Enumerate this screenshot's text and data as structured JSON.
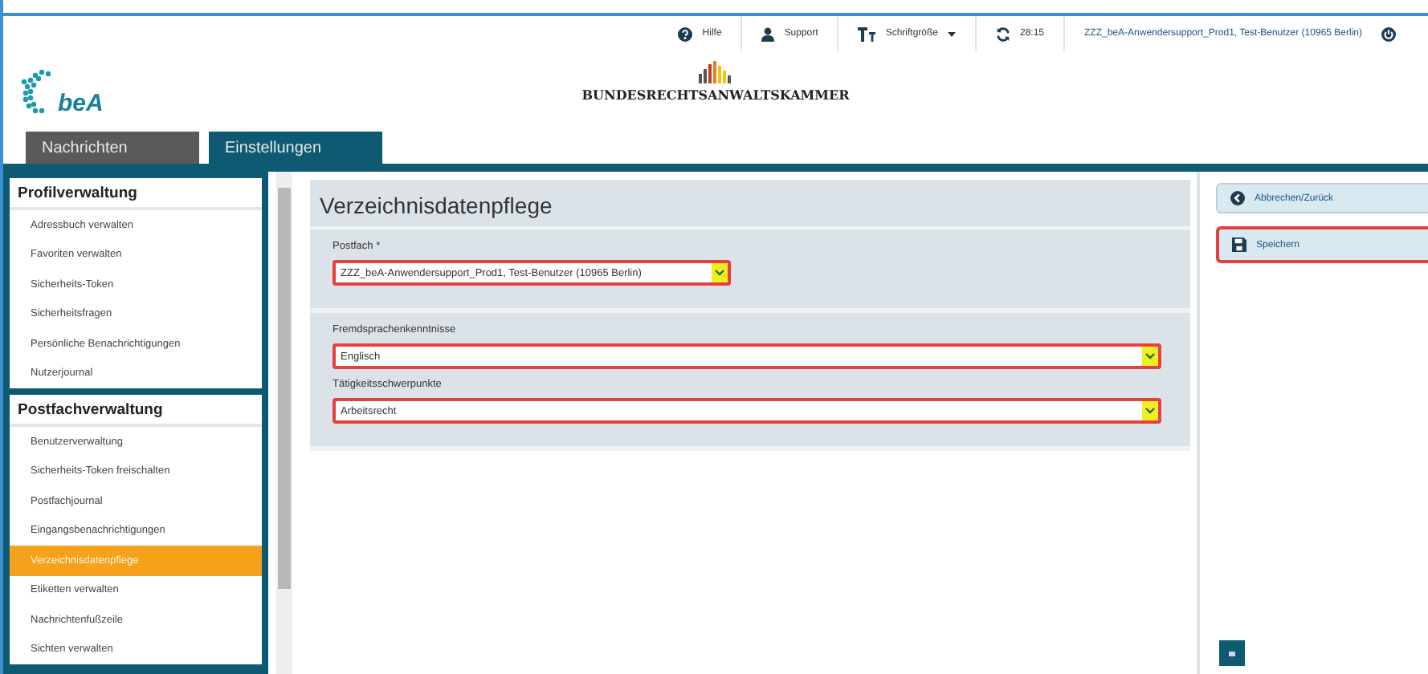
{
  "top_bar": {
    "items": [
      {
        "kind": "help",
        "label": "Hilfe"
      },
      {
        "kind": "user",
        "label": "Support"
      },
      {
        "kind": "font",
        "label": "Schriftgröße"
      },
      {
        "kind": "refresh",
        "label": "28:15"
      },
      {
        "kind": "account",
        "label": "ZZZ_beA-Anwendersupport_Prod1, Test-Benutzer (10965 Berlin)"
      }
    ]
  },
  "header": {
    "logo_text": "beA",
    "organization": "BUNDESRECHTSANWALTSKAMMER"
  },
  "tabs": [
    {
      "label": "Nachrichten",
      "selected": false
    },
    {
      "label": "Einstellungen",
      "selected": true
    }
  ],
  "sidebar": {
    "sections": [
      {
        "title": "Profilverwaltung",
        "items": [
          {
            "label": "Adressbuch verwalten",
            "selected": false
          },
          {
            "label": "Favoriten verwalten",
            "selected": false
          },
          {
            "label": "Sicherheits-Token",
            "selected": false
          },
          {
            "label": "Sicherheitsfragen",
            "selected": false
          },
          {
            "label": "Persönliche Benachrichtigungen",
            "selected": false
          },
          {
            "label": "Nutzerjournal",
            "selected": false
          }
        ]
      },
      {
        "title": "Postfachverwaltung",
        "items": [
          {
            "label": "Benutzerverwaltung",
            "selected": false
          },
          {
            "label": "Sicherheits-Token freischalten",
            "selected": false
          },
          {
            "label": "Postfachjournal",
            "selected": false
          },
          {
            "label": "Eingangsbenachrichtigungen",
            "selected": false
          },
          {
            "label": "Verzeichnisdatenpflege",
            "selected": true
          },
          {
            "label": "Etiketten verwalten",
            "selected": false
          },
          {
            "label": "Nachrichtenfußzeile",
            "selected": false
          },
          {
            "label": "Sichten verwalten",
            "selected": false
          }
        ]
      }
    ]
  },
  "main": {
    "title": "Verzeichnisdatenpflege",
    "sections": [
      {
        "fields": [
          {
            "label": "Postfach *",
            "value": "ZZZ_beA-Anwendersupport_Prod1, Test-Benutzer (10965 Berlin)",
            "kind": "short",
            "highlighted": true
          }
        ]
      },
      {
        "fields": [
          {
            "label": "Fremdsprachenkenntnisse",
            "value": "Englisch",
            "kind": "wide",
            "highlighted": true
          },
          {
            "label": "Tätigkeitsschwerpunkte",
            "value": "Arbeitsrecht",
            "kind": "wide",
            "highlighted": true
          }
        ]
      }
    ]
  },
  "actions": [
    {
      "kind": "back",
      "label": "Abbrechen/Zurück",
      "highlighted": false
    },
    {
      "kind": "save",
      "label": "Speichern",
      "highlighted": true
    }
  ]
}
